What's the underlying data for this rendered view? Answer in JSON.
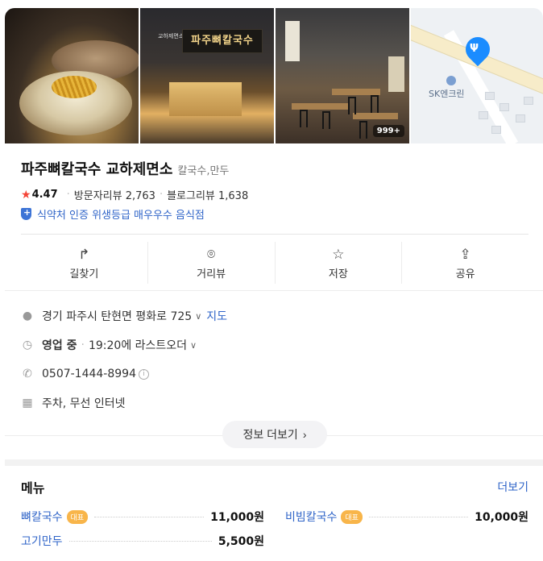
{
  "place": {
    "name": "파주뼈칼국수 교하제면소",
    "category": "칼국수,만두",
    "rating": "4.47",
    "visitor_reviews_label": "방문자리뷰 2,763",
    "blog_reviews_label": "블로그리뷰 1,638",
    "certification": "식약처 인증 위생등급 매우우수 음식점"
  },
  "photos": {
    "sign_text": "파주뼈칼국수",
    "sign_small": "교하제면소",
    "count_badge": "999+",
    "map_label": "SK엔크린"
  },
  "actions": [
    {
      "label": "길찾기",
      "icon": "directions-icon"
    },
    {
      "label": "거리뷰",
      "icon": "street-view-icon"
    },
    {
      "label": "저장",
      "icon": "star-icon"
    },
    {
      "label": "공유",
      "icon": "share-icon"
    }
  ],
  "info": {
    "address": "경기 파주시 탄현면 평화로 725",
    "map_link": "지도",
    "status": "영업 중",
    "last_order": "19:20에 라스트오더",
    "phone": "0507-1444-8994",
    "facilities": "주차, 무선 인터넷",
    "more_button": "정보 더보기"
  },
  "menu": {
    "title": "메뉴",
    "more": "더보기",
    "rep_badge": "대표",
    "items": [
      {
        "name": "뼈칼국수",
        "price": "11,000원"
      },
      {
        "name": "비빔칼국수",
        "price": "10,000원"
      },
      {
        "name": "고기만두",
        "price": "5,500원"
      }
    ]
  },
  "colors": {
    "link_blue": "#2f64c8",
    "star_red": "#f44336",
    "badge_orange": "#f8b54a",
    "map_pin": "#1a8cff"
  }
}
